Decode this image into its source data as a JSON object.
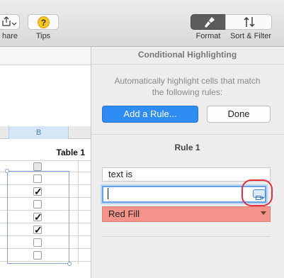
{
  "toolbar": {
    "share_label": "hare",
    "tips_label": "Tips",
    "tips_icon_glyph": "?",
    "format_label": "Format",
    "sort_filter_label": "Sort & Filter"
  },
  "sheet": {
    "column_label": "B",
    "table_title": "Table 1",
    "checkbox_rows": [
      false,
      true,
      false,
      true,
      true,
      false,
      false
    ],
    "check_glyph": "✓"
  },
  "panel": {
    "title": "Conditional Highlighting",
    "description_line1": "Automatically highlight cells that match",
    "description_line2": "the following rules:",
    "add_rule_label": "Add a Rule...",
    "done_label": "Done",
    "rule_title": "Rule 1",
    "condition_value": "text is",
    "text_value": "",
    "fill_style": "Red Fill"
  },
  "colors": {
    "accent": "#2f8cf3",
    "red_fill": "#f4938a",
    "highlight_circle": "#e03040"
  }
}
